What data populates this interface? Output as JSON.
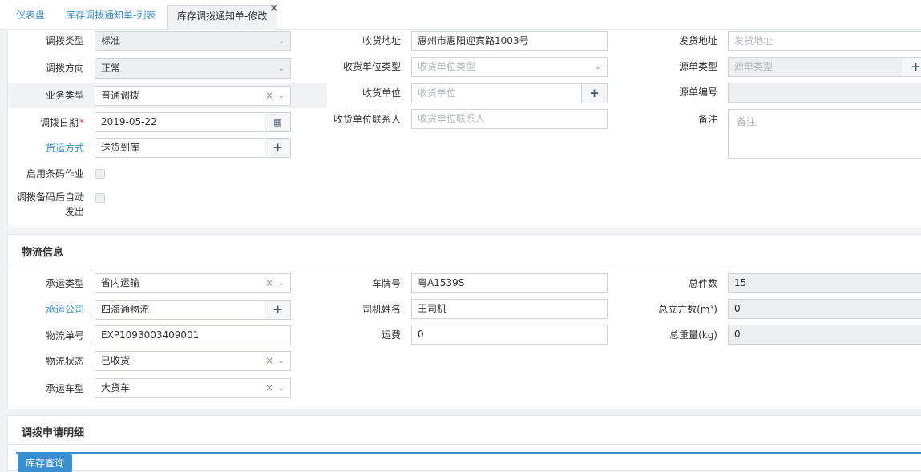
{
  "tabs": [
    {
      "label": "仪表盘"
    },
    {
      "label": "库存调拨通知单-列表"
    },
    {
      "label": "库存调拨通知单-修改"
    }
  ],
  "basic": {
    "transfer_type": {
      "label": "调拨类型",
      "value": "标准"
    },
    "transfer_direction": {
      "label": "调拨方向",
      "value": "正常"
    },
    "business_type": {
      "label": "业务类型",
      "value": "普通调拨"
    },
    "transfer_date": {
      "label": "调拨日期",
      "required_mark": "*",
      "value": "2019-05-22"
    },
    "shipping_method": {
      "label": "货运方式",
      "value": "送货到库"
    },
    "enable_barcode": {
      "label": "启用条码作业"
    },
    "auto_ship": {
      "label_line1": "调拨备码后自动",
      "label_line2": "发出"
    },
    "receive_address": {
      "label": "收货地址",
      "value": "惠州市惠阳迎宾路1003号"
    },
    "receiver_unit_type": {
      "label": "收货单位类型",
      "placeholder": "收货单位类型"
    },
    "receiver_unit": {
      "label": "收货单位",
      "placeholder": "收货单位"
    },
    "receiver_contact": {
      "label": "收货单位联系人",
      "placeholder": "收货单位联系人"
    },
    "ship_address": {
      "label": "发货地址",
      "placeholder": "发货地址"
    },
    "source_type": {
      "label": "源单类型",
      "placeholder": "源单类型"
    },
    "source_number": {
      "label": "源单编号",
      "value": ""
    },
    "remark": {
      "label": "备注",
      "placeholder": "备注"
    }
  },
  "logistics": {
    "title": "物流信息",
    "carrier_type": {
      "label": "承运类型",
      "value": "省内运输"
    },
    "carrier_company": {
      "label": "承运公司",
      "value": "四海通物流"
    },
    "tracking_number": {
      "label": "物流单号",
      "value": "EXP1093003409001"
    },
    "logistics_status": {
      "label": "物流状态",
      "value": "已收货"
    },
    "vehicle_type": {
      "label": "承运车型",
      "value": "大货车"
    },
    "plate_number": {
      "label": "车牌号",
      "value": "粤A1539S"
    },
    "driver_name": {
      "label": "司机姓名",
      "value": "王司机"
    },
    "freight": {
      "label": "运费",
      "value": "0"
    },
    "total_pieces": {
      "label": "总件数",
      "value": "15"
    },
    "total_volume": {
      "label": "总立方数(m³)",
      "value": "0"
    },
    "total_weight": {
      "label": "总重量(kg)",
      "value": "0"
    }
  },
  "detail": {
    "title": "调拨申请明细",
    "stock_query_button": "库存查询"
  },
  "icons": {
    "dropdown": "chevron-down",
    "clear": "×",
    "add": "+",
    "calendar": "calendar",
    "close": "×"
  },
  "colors": {
    "accent": "#3a8fd0",
    "required": "#e4393c"
  }
}
